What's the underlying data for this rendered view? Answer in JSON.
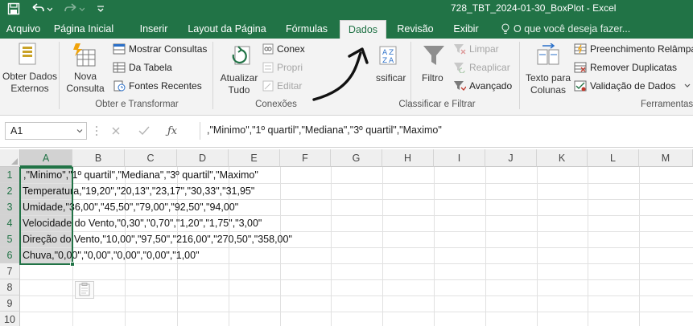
{
  "window": {
    "title": "728_TBT_2024-01-30_BoxPlot - Excel"
  },
  "tabs": [
    {
      "label": "Arquivo"
    },
    {
      "label": "Página Inicial"
    },
    {
      "label": "Inserir"
    },
    {
      "label": "Layout da Página"
    },
    {
      "label": "Fórmulas"
    },
    {
      "label": "Dados"
    },
    {
      "label": "Revisão"
    },
    {
      "label": "Exibir"
    }
  ],
  "active_tab": "Dados",
  "tell_me": "O que você deseja fazer...",
  "ribbon": {
    "external_data": {
      "line1": "Obter Dados",
      "line2": "Externos"
    },
    "new_query": {
      "line1": "Nova",
      "line2": "Consulta"
    },
    "show_queries": "Mostrar Consultas",
    "from_table": "Da Tabela",
    "recent_sources": "Fontes Recentes",
    "group_get_transform": "Obter e Transformar",
    "refresh_all": {
      "line1": "Atualizar",
      "line2": "Tudo"
    },
    "connections": "Conex",
    "properties": "Propri",
    "edit_links": "Editar",
    "group_connections": "Conexões",
    "sort": "ssificar",
    "filter": "Filtro",
    "clear": "Limpar",
    "reapply": "Reaplicar",
    "advanced": "Avançado",
    "group_sort_filter": "Classificar e Filtrar",
    "text_to_columns": {
      "line1": "Texto para",
      "line2": "Colunas"
    },
    "flash_fill": "Preenchimento Relâmpa",
    "remove_duplicates": "Remover Duplicatas",
    "data_validation": "Validação de Dados",
    "group_tools": "Ferramentas"
  },
  "formula_bar": {
    "name_box": "A1",
    "formula": ",\"Minimo\",\"1º quartil\",\"Mediana\",\"3º quartil\",\"Maximo\""
  },
  "columns": [
    "A",
    "B",
    "C",
    "D",
    "E",
    "F",
    "G",
    "H",
    "I",
    "J",
    "K",
    "L",
    "M"
  ],
  "rows": [
    "1",
    "2",
    "3",
    "4",
    "5",
    "6",
    "7",
    "8",
    "9",
    "10"
  ],
  "cells": [
    ",\"Minimo\",\"1º quartil\",\"Mediana\",\"3º quartil\",\"Maximo\"",
    "Temperatura,\"19,20\",\"20,13\",\"23,17\",\"30,33\",\"31,95\"",
    "Umidade,\"36,00\",\"45,50\",\"79,00\",\"92,50\",\"94,00\"",
    "Velocidade do Vento,\"0,30\",\"0,70\",\"1,20\",\"1,75\",\"3,00\"",
    "Direção do Vento,\"10,00\",\"97,50\",\"216,00\",\"270,50\",\"358,00\"",
    "Chuva,\"0,00\",\"0,00\",\"0,00\",\"0,00\",\"1,00\""
  ]
}
